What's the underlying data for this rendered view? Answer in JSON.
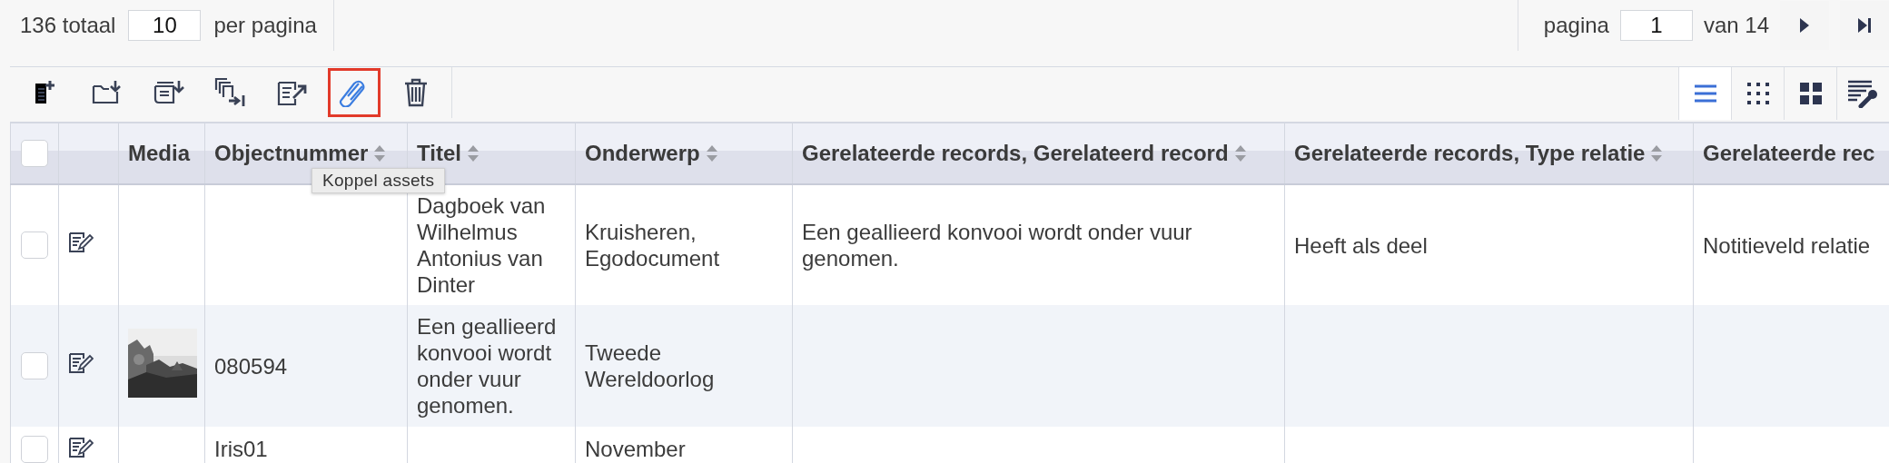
{
  "pager": {
    "total": "136 totaal",
    "per_page": "10",
    "per_page_label": "per pagina",
    "page_label": "pagina",
    "page": "1",
    "page_count": "van 14"
  },
  "toolbar": {
    "tools": [
      {
        "kind": "new"
      },
      {
        "kind": "import"
      },
      {
        "kind": "stack"
      },
      {
        "kind": "copy"
      },
      {
        "kind": "export"
      },
      {
        "kind": "link",
        "selected": true,
        "tooltip": "Koppel assets"
      },
      {
        "kind": "delete"
      }
    ],
    "views": [
      {
        "kind": "list",
        "selected": true
      },
      {
        "kind": "small-grid",
        "selected": false
      },
      {
        "kind": "large-grid",
        "selected": false
      },
      {
        "kind": "settings",
        "selected": false
      }
    ]
  },
  "table": {
    "all_checked": false,
    "columns": [
      {
        "label": "Media",
        "sortable": false
      },
      {
        "label": "Objectnummer",
        "sortable": true
      },
      {
        "label": "Titel",
        "sortable": true
      },
      {
        "label": "Onderwerp",
        "sortable": true
      },
      {
        "label": "Gerelateerde records, Gerelateerd record",
        "sortable": true
      },
      {
        "label": "Gerelateerde records, Type relatie",
        "sortable": true
      },
      {
        "label": "Gerelateerde rec",
        "sortable": false
      }
    ],
    "rows": [
      {
        "checked": false,
        "cells": [
          null,
          null,
          "Dagboek van Wilhelmus Antonius van Dinter",
          "Kruisheren, Egodocument",
          "Een geallieerd konvooi wordt onder vuur genomen.",
          "Heeft als deel",
          "Notitieveld relatie"
        ]
      },
      {
        "checked": false,
        "cells": [
          {
            "kind": "picture"
          },
          "080594",
          "Een geallieerd konvooi wordt onder vuur genomen.",
          "Tweede Wereldoorlog",
          null,
          null,
          null
        ]
      },
      {
        "checked": false,
        "cells": [
          null,
          "Iris01",
          null,
          "November",
          null,
          null,
          null
        ]
      }
    ]
  }
}
